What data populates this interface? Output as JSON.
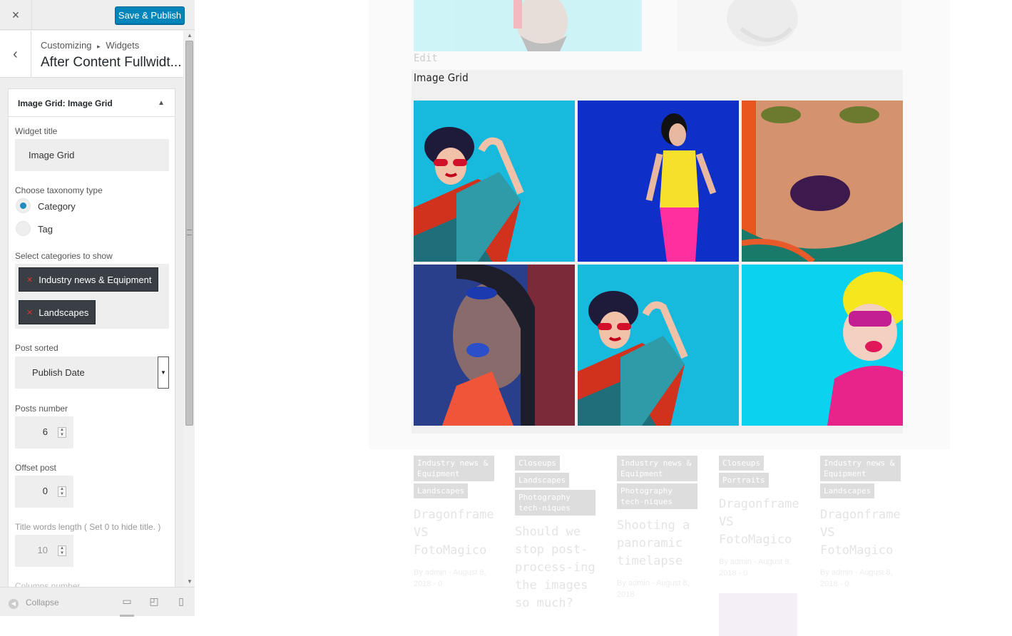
{
  "topbar": {
    "close_icon": "×",
    "publish_label": "Save & Publish"
  },
  "breadcrumb": {
    "back_icon": "‹",
    "parent": "Customizing",
    "separator": "▸",
    "child": "Widgets",
    "title": "After Content Fullwidt..."
  },
  "widget": {
    "header_prefix": "Image Grid:",
    "header_name": "Image Grid",
    "title_label": "Widget title",
    "title_value": "Image Grid",
    "taxonomy_label": "Choose taxonomy type",
    "taxonomy_options": [
      "Category",
      "Tag"
    ],
    "taxonomy_selected": "Category",
    "categories_label": "Select categories to show",
    "categories": [
      "Industry news & Equipment",
      "Landscapes"
    ],
    "sorted_label": "Post sorted",
    "sorted_value": "Publish Date",
    "posts_number_label": "Posts number",
    "posts_number": "6",
    "offset_label": "Offset post",
    "offset_value": "0",
    "title_length_label": "Title words length ( Set 0 to hide title. )",
    "title_length_value": "10",
    "columns_label": "Columns number"
  },
  "footer": {
    "collapse_label": "Collapse"
  },
  "preview": {
    "edit_link": "Edit",
    "grid_title": "Image Grid",
    "posts": [
      {
        "tags": [
          "Industry news & Equipment",
          "Landscapes"
        ],
        "title": "Dragonframe VS FotoMagico",
        "meta": "By admin - August 8, 2018 - 0"
      },
      {
        "tags": [
          "Closeups",
          "Landscapes",
          "Photography tech-niques"
        ],
        "title": "Should we stop post-process-ing the images so much?",
        "meta": ""
      },
      {
        "tags": [
          "Industry news & Equipment",
          "Photography tech-niques"
        ],
        "title": "Shooting a panoramic timelapse",
        "meta": "By admin - August 8, 2018"
      },
      {
        "tags": [
          "Closeups",
          "Portraits"
        ],
        "title": "Dragonframe VS FotoMagico",
        "meta": "By admin - August 8, 2018 - 0"
      },
      {
        "tags": [
          "Industry news & Equipment",
          "Landscapes"
        ],
        "title": "Dragonframe VS FotoMagico",
        "meta": "By admin - August 8, 2018 - 0"
      }
    ]
  }
}
